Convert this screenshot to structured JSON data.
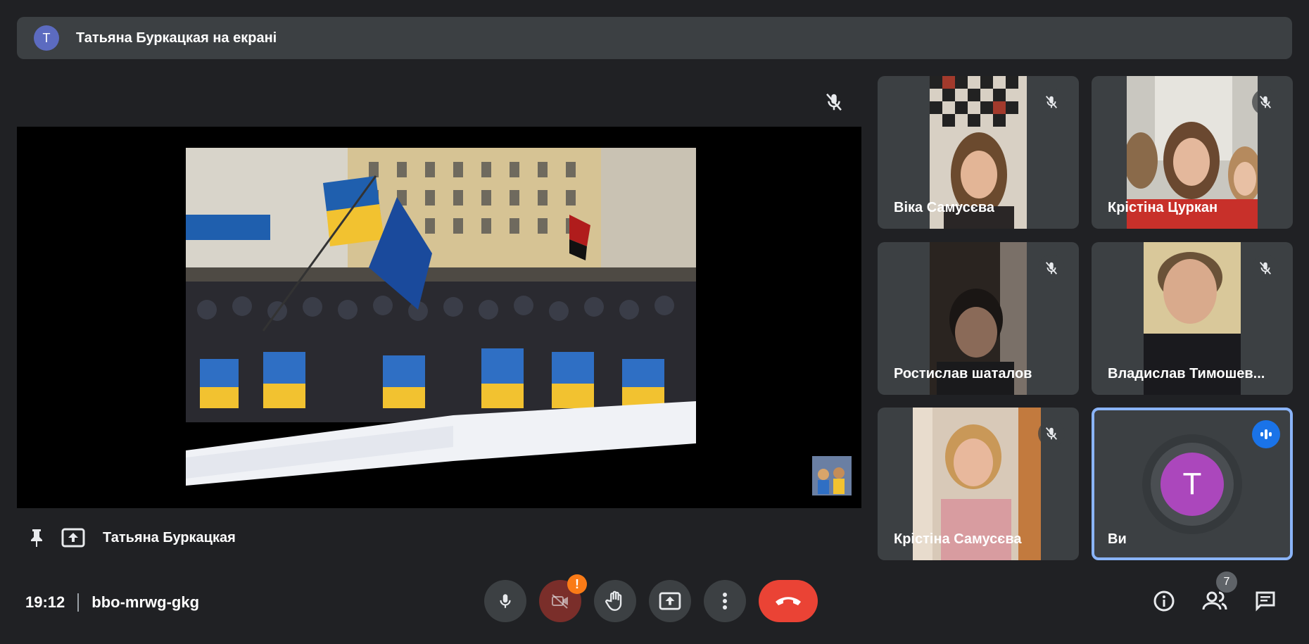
{
  "banner": {
    "avatar_letter": "T",
    "text": "Татьяна Буркацкая на екрані"
  },
  "stage": {
    "presenter": "Татьяна Буркацкая"
  },
  "participants": [
    {
      "name": "Віка Самусєва",
      "muted": true
    },
    {
      "name": "Крістіна Цуркан",
      "muted": true
    },
    {
      "name": "Ростислав шаталов",
      "muted": true
    },
    {
      "name": "Владислав Тимошев...",
      "muted": true
    },
    {
      "name": "Крістіна Самусєва",
      "muted": true
    },
    {
      "name": "Ви",
      "avatar_letter": "T",
      "speaking": true
    }
  ],
  "meeting": {
    "time": "19:12",
    "code": "bbo-mrwg-gkg"
  },
  "controls": {
    "camera_warning": "!",
    "people_count": "7"
  },
  "colors": {
    "background": "#202124",
    "tile": "#3c4043",
    "accent": "#8ab4f8",
    "end_call": "#ea4335",
    "self_avatar": "#ab47bc"
  }
}
